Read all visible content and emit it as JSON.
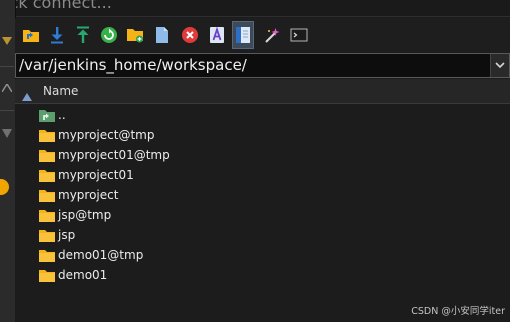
{
  "quick_connect": {
    "placeholder": "uick connect..."
  },
  "toolbar": {
    "buttons": [
      {
        "icon": "parent-folder-icon"
      },
      {
        "icon": "download-icon"
      },
      {
        "icon": "upload-icon"
      },
      {
        "icon": "refresh-icon"
      },
      {
        "icon": "new-folder-icon"
      },
      {
        "icon": "new-file-icon"
      },
      {
        "icon": "delete-icon"
      },
      {
        "icon": "rename-icon"
      },
      {
        "icon": "properties-icon"
      },
      {
        "icon": "magic-wand-icon"
      },
      {
        "icon": "terminal-icon"
      }
    ]
  },
  "path": {
    "value": "/var/jenkins_home/workspace/"
  },
  "list": {
    "columns": [
      {
        "label": "Name"
      }
    ],
    "items": [
      {
        "name": "..",
        "type": "parent"
      },
      {
        "name": "myproject@tmp",
        "type": "folder"
      },
      {
        "name": "myproject01@tmp",
        "type": "folder"
      },
      {
        "name": "myproject01",
        "type": "folder"
      },
      {
        "name": "myproject",
        "type": "folder"
      },
      {
        "name": "jsp@tmp",
        "type": "folder"
      },
      {
        "name": "jsp",
        "type": "folder"
      },
      {
        "name": "demo01@tmp",
        "type": "folder"
      },
      {
        "name": "demo01",
        "type": "folder"
      }
    ]
  },
  "watermark": {
    "text": "CSDN @小安同学iter"
  },
  "colors": {
    "folder": "#f5b316",
    "accent": "#3d4a5a"
  }
}
